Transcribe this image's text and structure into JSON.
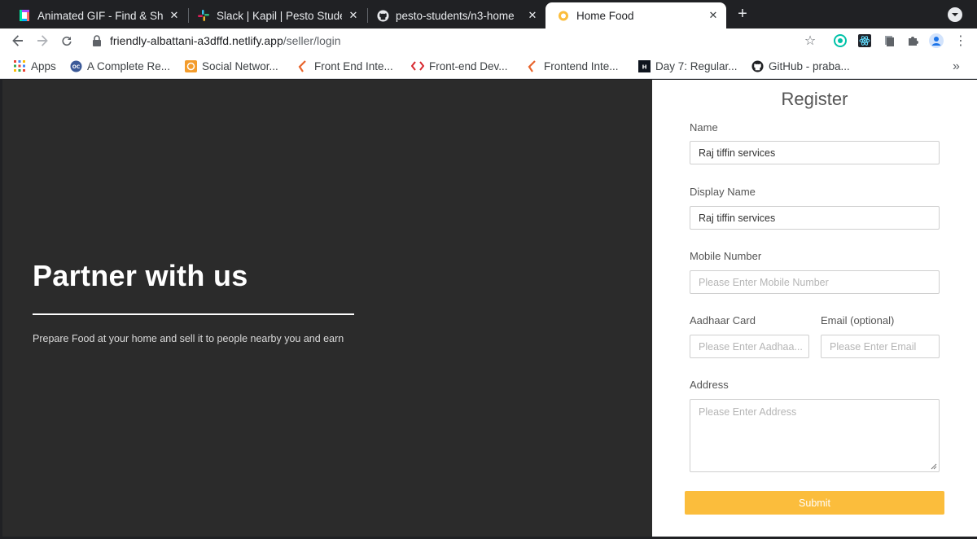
{
  "tabs": [
    {
      "title": "Animated GIF - Find & Sha",
      "icon": "gif-tab-icon"
    },
    {
      "title": "Slack | Kapil | Pesto Stude",
      "icon": "slack-tab-icon"
    },
    {
      "title": "pesto-students/n3-home",
      "icon": "github-tab-icon"
    },
    {
      "title": "Home Food",
      "icon": "home-food-tab-icon"
    }
  ],
  "toolbar": {
    "url_host": "friendly-albattani-a3dffd.netlify.app",
    "url_path": "/seller/login"
  },
  "bookmarks": [
    {
      "label": "Apps",
      "icon": "apps-grid-icon"
    },
    {
      "label": "A Complete Re...",
      "icon": "oc-icon"
    },
    {
      "label": "Social Networ...",
      "icon": "social-network-icon"
    },
    {
      "label": "Front End Inte...",
      "icon": "interview-icon"
    },
    {
      "label": "Front-end Dev...",
      "icon": "code-icon"
    },
    {
      "label": "Frontend Inte...",
      "icon": "interview-icon"
    },
    {
      "label": "Day 7: Regular...",
      "icon": "hackerrank-icon"
    },
    {
      "label": "GitHub - praba...",
      "icon": "github-icon"
    }
  ],
  "hero": {
    "title": "Partner with us",
    "subtitle": "Prepare Food at your home and sell it to people nearby you and earn"
  },
  "form": {
    "title": "Register",
    "name_label": "Name",
    "name_value": "Raj tiffin services",
    "display_name_label": "Display Name",
    "display_name_value": "Raj tiffin services",
    "mobile_label": "Mobile Number",
    "mobile_placeholder": "Please Enter Mobile Number",
    "aadhaar_label": "Aadhaar Card",
    "aadhaar_placeholder": "Please Enter Aadhaa...",
    "email_label": "Email (optional)",
    "email_placeholder": "Please Enter Email",
    "address_label": "Address",
    "address_placeholder": "Please Enter Address",
    "submit_label": "Submit"
  },
  "colors": {
    "accent": "#fbbd3c",
    "hero_bg": "#2b2b2b",
    "chrome_dark": "#202124"
  }
}
